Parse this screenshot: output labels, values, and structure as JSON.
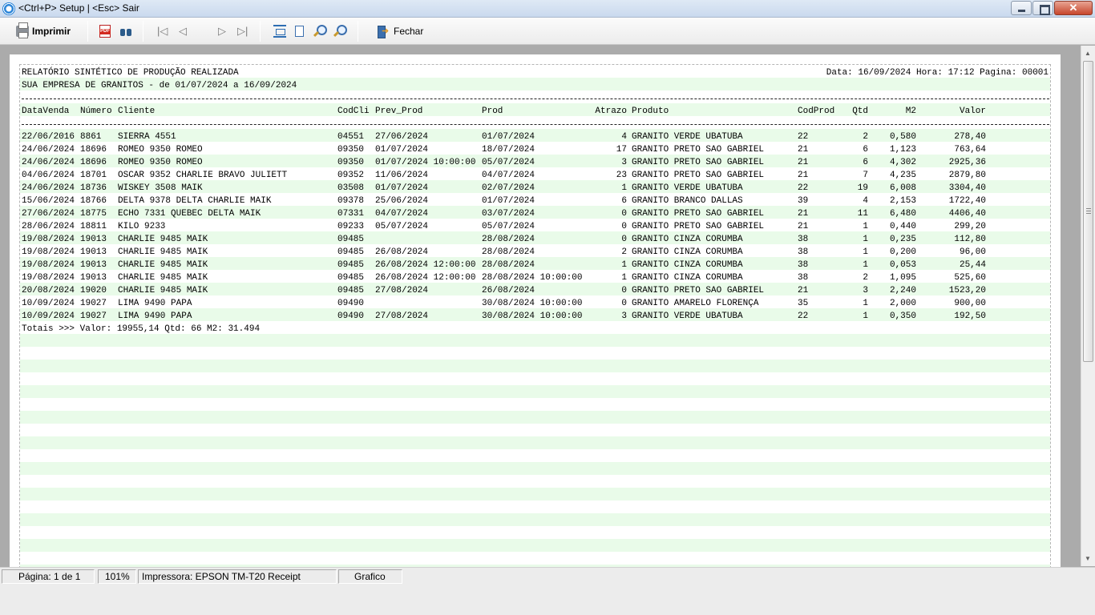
{
  "window": {
    "title": "<Ctrl+P> Setup | <Esc> Sair"
  },
  "toolbar": {
    "print_label": "Imprimir",
    "close_label": "Fechar"
  },
  "report": {
    "title": "RELATÓRIO SINTÉTICO DE PRODUÇÃO REALIZADA",
    "subtitle": "SUA EMPRESA DE GRANITOS - de 01/07/2024 a 16/09/2024",
    "header_info": "Data: 16/09/2024 Hora: 17:12 Pagina: 00001",
    "columns": {
      "data_venda": "DataVenda",
      "numero": "Número",
      "cliente": "Cliente",
      "codcli": "CodCli",
      "prev_prod": "Prev_Prod",
      "prod": "Prod",
      "atrazo": "Atrazo",
      "produto": "Produto",
      "codprod": "CodProd",
      "qtd": "Qtd",
      "m2": "M2",
      "valor": "Valor"
    },
    "rows": [
      {
        "data_venda": "22/06/2016",
        "numero": "8861",
        "cliente": "SIERRA 4551",
        "codcli": "04551",
        "prev_prod": "27/06/2024",
        "prod": "01/07/2024",
        "atrazo": "4",
        "produto": "GRANITO VERDE UBATUBA",
        "codprod": "22",
        "qtd": "2",
        "m2": "0,580",
        "valor": "278,40"
      },
      {
        "data_venda": "24/06/2024",
        "numero": "18696",
        "cliente": "ROMEO 9350 ROMEO",
        "codcli": "09350",
        "prev_prod": "01/07/2024",
        "prod": "18/07/2024",
        "atrazo": "17",
        "produto": "GRANITO PRETO SAO GABRIEL",
        "codprod": "21",
        "qtd": "6",
        "m2": "1,123",
        "valor": "763,64"
      },
      {
        "data_venda": "24/06/2024",
        "numero": "18696",
        "cliente": "ROMEO 9350 ROMEO",
        "codcli": "09350",
        "prev_prod": "01/07/2024 10:00:00",
        "prod": "05/07/2024",
        "atrazo": "3",
        "produto": "GRANITO PRETO SAO GABRIEL",
        "codprod": "21",
        "qtd": "6",
        "m2": "4,302",
        "valor": "2925,36"
      },
      {
        "data_venda": "04/06/2024",
        "numero": "18701",
        "cliente": "OSCAR 9352 CHARLIE BRAVO JULIETT",
        "codcli": "09352",
        "prev_prod": "11/06/2024",
        "prod": "04/07/2024",
        "atrazo": "23",
        "produto": "GRANITO PRETO SAO GABRIEL",
        "codprod": "21",
        "qtd": "7",
        "m2": "4,235",
        "valor": "2879,80"
      },
      {
        "data_venda": "24/06/2024",
        "numero": "18736",
        "cliente": "WISKEY 3508 MAIK",
        "codcli": "03508",
        "prev_prod": "01/07/2024",
        "prod": "02/07/2024",
        "atrazo": "1",
        "produto": "GRANITO VERDE UBATUBA",
        "codprod": "22",
        "qtd": "19",
        "m2": "6,008",
        "valor": "3304,40"
      },
      {
        "data_venda": "15/06/2024",
        "numero": "18766",
        "cliente": "DELTA 9378 DELTA CHARLIE MAIK",
        "codcli": "09378",
        "prev_prod": "25/06/2024",
        "prod": "01/07/2024",
        "atrazo": "6",
        "produto": "GRANITO BRANCO DALLAS",
        "codprod": "39",
        "qtd": "4",
        "m2": "2,153",
        "valor": "1722,40"
      },
      {
        "data_venda": "27/06/2024",
        "numero": "18775",
        "cliente": "ECHO 7331 QUEBEC DELTA MAIK",
        "codcli": "07331",
        "prev_prod": "04/07/2024",
        "prod": "03/07/2024",
        "atrazo": "0",
        "produto": "GRANITO PRETO SAO GABRIEL",
        "codprod": "21",
        "qtd": "11",
        "m2": "6,480",
        "valor": "4406,40"
      },
      {
        "data_venda": "28/06/2024",
        "numero": "18811",
        "cliente": "KILO 9233",
        "codcli": "09233",
        "prev_prod": "05/07/2024",
        "prod": "05/07/2024",
        "atrazo": "0",
        "produto": "GRANITO PRETO SAO GABRIEL",
        "codprod": "21",
        "qtd": "1",
        "m2": "0,440",
        "valor": "299,20"
      },
      {
        "data_venda": "19/08/2024",
        "numero": "19013",
        "cliente": "CHARLIE 9485 MAIK",
        "codcli": "09485",
        "prev_prod": "",
        "prod": "28/08/2024",
        "atrazo": "0",
        "produto": "GRANITO CINZA CORUMBA",
        "codprod": "38",
        "qtd": "1",
        "m2": "0,235",
        "valor": "112,80"
      },
      {
        "data_venda": "19/08/2024",
        "numero": "19013",
        "cliente": "CHARLIE 9485 MAIK",
        "codcli": "09485",
        "prev_prod": "26/08/2024",
        "prod": "28/08/2024",
        "atrazo": "2",
        "produto": "GRANITO CINZA CORUMBA",
        "codprod": "38",
        "qtd": "1",
        "m2": "0,200",
        "valor": "96,00"
      },
      {
        "data_venda": "19/08/2024",
        "numero": "19013",
        "cliente": "CHARLIE 9485 MAIK",
        "codcli": "09485",
        "prev_prod": "26/08/2024 12:00:00",
        "prod": "28/08/2024",
        "atrazo": "1",
        "produto": "GRANITO CINZA CORUMBA",
        "codprod": "38",
        "qtd": "1",
        "m2": "0,053",
        "valor": "25,44"
      },
      {
        "data_venda": "19/08/2024",
        "numero": "19013",
        "cliente": "CHARLIE 9485 MAIK",
        "codcli": "09485",
        "prev_prod": "26/08/2024 12:00:00",
        "prod": "28/08/2024 10:00:00",
        "atrazo": "1",
        "produto": "GRANITO CINZA CORUMBA",
        "codprod": "38",
        "qtd": "2",
        "m2": "1,095",
        "valor": "525,60"
      },
      {
        "data_venda": "20/08/2024",
        "numero": "19020",
        "cliente": "CHARLIE 9485 MAIK",
        "codcli": "09485",
        "prev_prod": "27/08/2024",
        "prod": "26/08/2024",
        "atrazo": "0",
        "produto": "GRANITO PRETO SAO GABRIEL",
        "codprod": "21",
        "qtd": "3",
        "m2": "2,240",
        "valor": "1523,20"
      },
      {
        "data_venda": "10/09/2024",
        "numero": "19027",
        "cliente": "LIMA 9490 PAPA",
        "codcli": "09490",
        "prev_prod": "",
        "prod": "30/08/2024 10:00:00",
        "atrazo": "0",
        "produto": "GRANITO AMARELO FLORENÇA",
        "codprod": "35",
        "qtd": "1",
        "m2": "2,000",
        "valor": "900,00"
      },
      {
        "data_venda": "10/09/2024",
        "numero": "19027",
        "cliente": "LIMA 9490 PAPA",
        "codcli": "09490",
        "prev_prod": "27/08/2024",
        "prod": "30/08/2024 10:00:00",
        "atrazo": "3",
        "produto": "GRANITO VERDE UBATUBA",
        "codprod": "22",
        "qtd": "1",
        "m2": "0,350",
        "valor": "192,50"
      }
    ],
    "totals": "Totais >>> Valor: 19955,14 Qtd: 66 M2: 31.494"
  },
  "statusbar": {
    "page": "Página: 1 de 1",
    "zoom": "101%",
    "printer": "Impressora: EPSON TM-T20 Receipt",
    "mode": "Grafico"
  }
}
